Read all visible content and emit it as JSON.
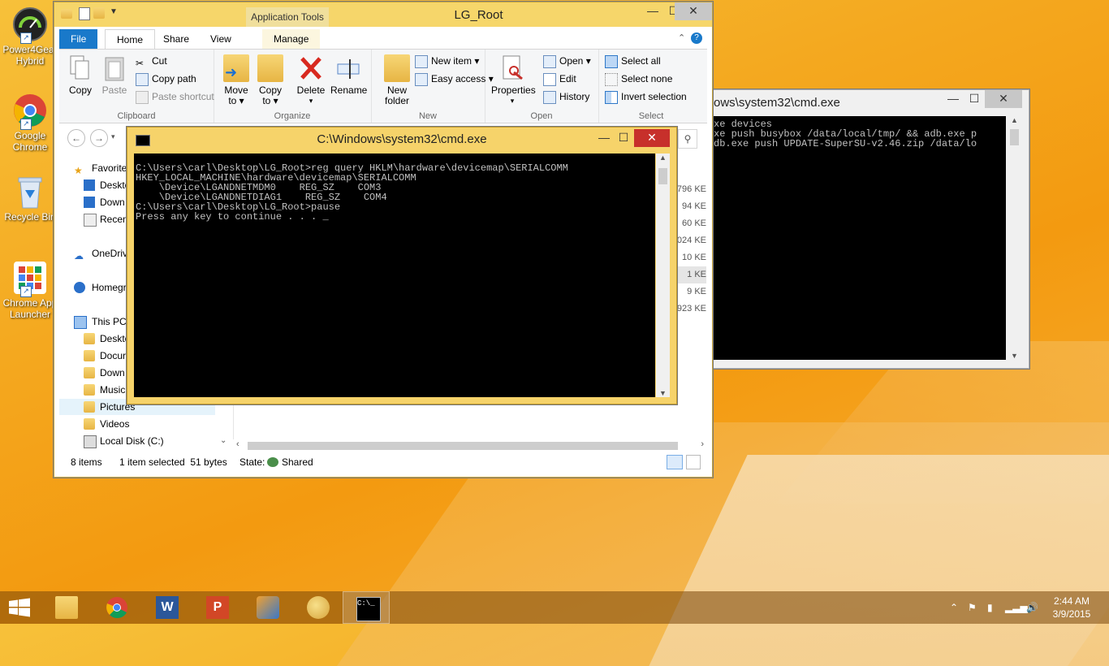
{
  "desktop": {
    "icons": [
      {
        "label": "Power4Gear Hybrid",
        "icon": "gauge-icon"
      },
      {
        "label": "Google Chrome",
        "icon": "chrome-icon"
      },
      {
        "label": "Recycle Bin",
        "icon": "recycle-bin-icon"
      },
      {
        "label": "Chrome App Launcher",
        "icon": "app-launcher-icon"
      }
    ]
  },
  "cmd_back": {
    "title": "ows\\system32\\cmd.exe",
    "lines": [
      "xe devices",
      "",
      "",
      "",
      "",
      "xe push busybox /data/local/tmp/ && adb.exe p",
      "db.exe push UPDATE-SuperSU-v2.46.zip /data/lo"
    ]
  },
  "explorer": {
    "title": "LG_Root",
    "context_tab": "Application Tools",
    "tabs": {
      "file": "File",
      "home": "Home",
      "share": "Share",
      "view": "View",
      "manage": "Manage"
    },
    "clipboard": {
      "label": "Clipboard",
      "copy": "Copy",
      "paste": "Paste",
      "cut": "Cut",
      "copy_path": "Copy path",
      "paste_shortcut": "Paste shortcut"
    },
    "organize": {
      "label": "Organize",
      "move_to": "Move",
      "move_to2": "to",
      "copy_to": "Copy",
      "copy_to2": "to",
      "delete": "Delete",
      "rename": "Rename"
    },
    "new": {
      "label": "New",
      "new_folder": "New",
      "new_folder2": "folder",
      "new_item": "New item",
      "easy_access": "Easy access"
    },
    "open": {
      "label": "Open",
      "properties": "Properties",
      "open": "Open",
      "edit": "Edit",
      "history": "History"
    },
    "select": {
      "label": "Select",
      "select_all": "Select all",
      "select_none": "Select none",
      "invert": "Invert selection"
    },
    "nav": {
      "favorites": "Favorite",
      "desktop": "Deskto",
      "downloads": "Down",
      "recent": "Recen",
      "onedrive": "OneDriv",
      "homegroup": "Homegr",
      "this_pc": "This PC",
      "pc_desktop": "Deskto",
      "documents": "Docur",
      "pc_downloads": "Down",
      "music": "Music",
      "pictures": "Pictures",
      "videos": "Videos",
      "local_disk": "Local Disk (C:)"
    },
    "sizes": [
      "796 KE",
      "94 KE",
      "60 KE",
      ",024 KE",
      "10 KE",
      "1 KE",
      "9 KE",
      ",923 KE"
    ],
    "status": {
      "items": "8 items",
      "selected": "1 item selected  51 bytes",
      "state_label": "State:",
      "state_value": "Shared"
    }
  },
  "cmd_front": {
    "title": "C:\\Windows\\system32\\cmd.exe",
    "lines": [
      "C:\\Users\\carl\\Desktop\\LG_Root>reg query HKLM\\hardware\\devicemap\\SERIALCOMM",
      "",
      "HKEY_LOCAL_MACHINE\\hardware\\devicemap\\SERIALCOMM",
      "    \\Device\\LGANDNETMDM0    REG_SZ    COM3",
      "    \\Device\\LGANDNETDIAG1    REG_SZ    COM4",
      "",
      "",
      "C:\\Users\\carl\\Desktop\\LG_Root>pause",
      "Press any key to continue . . . _"
    ]
  },
  "taskbar": {
    "time": "2:44 AM",
    "date": "3/9/2015",
    "apps": [
      "file-explorer-icon",
      "chrome-icon",
      "word-icon",
      "powerpoint-icon",
      "tool-icon",
      "paint-icon",
      "cmd-icon"
    ]
  },
  "colors": {
    "explorer_title": "#f6d66a",
    "file_tab": "#1979ca",
    "close_red": "#c7302b"
  }
}
